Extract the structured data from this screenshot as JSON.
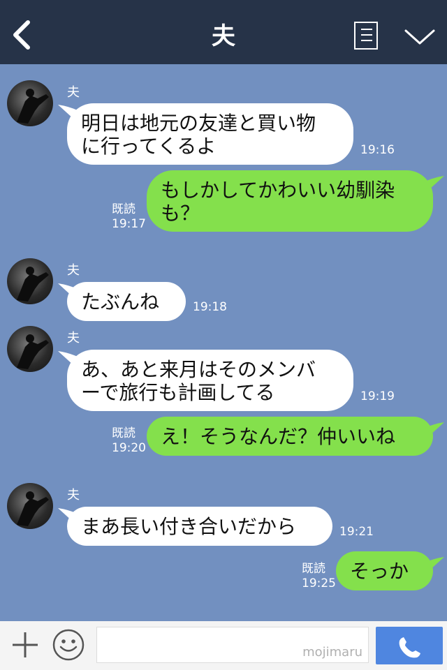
{
  "header": {
    "title": "夫",
    "back_icon": "chevron-left-icon",
    "menu_icon": "memo-icon",
    "expand_icon": "chevron-down-icon"
  },
  "colors": {
    "header_bg": "#263348",
    "chat_bg": "#7290c0",
    "incoming_bubble": "#ffffff",
    "outgoing_bubble": "#84e04c",
    "call_button": "#4f86e0"
  },
  "messages": [
    {
      "direction": "in",
      "sender": "夫",
      "lines": [
        "明日は地元の友達と買い物",
        "に行ってくるよ"
      ],
      "time": "19:16"
    },
    {
      "direction": "out",
      "lines": [
        "もしかしてかわいい幼馴染",
        "も？"
      ],
      "read": "既読",
      "time": "19:17"
    },
    {
      "direction": "in",
      "sender": "夫",
      "lines": [
        "たぶんね"
      ],
      "time": "19:18"
    },
    {
      "direction": "in",
      "sender": "夫",
      "lines": [
        "あ、あと来月はそのメンバ",
        "ーで旅行も計画してる"
      ],
      "time": "19:19"
    },
    {
      "direction": "out",
      "lines": [
        "え！そうなんだ？仲いいね"
      ],
      "read": "既読",
      "time": "19:20"
    },
    {
      "direction": "in",
      "sender": "夫",
      "lines": [
        "まあ長い付き合いだから"
      ],
      "time": "19:21"
    },
    {
      "direction": "out",
      "lines": [
        "そっか"
      ],
      "read": "既読",
      "time": "19:25"
    }
  ],
  "footer": {
    "input_value": "",
    "watermark": "mojimaru",
    "plus_icon": "plus-icon",
    "emoji_icon": "smiley-icon",
    "call_icon": "phone-icon"
  }
}
